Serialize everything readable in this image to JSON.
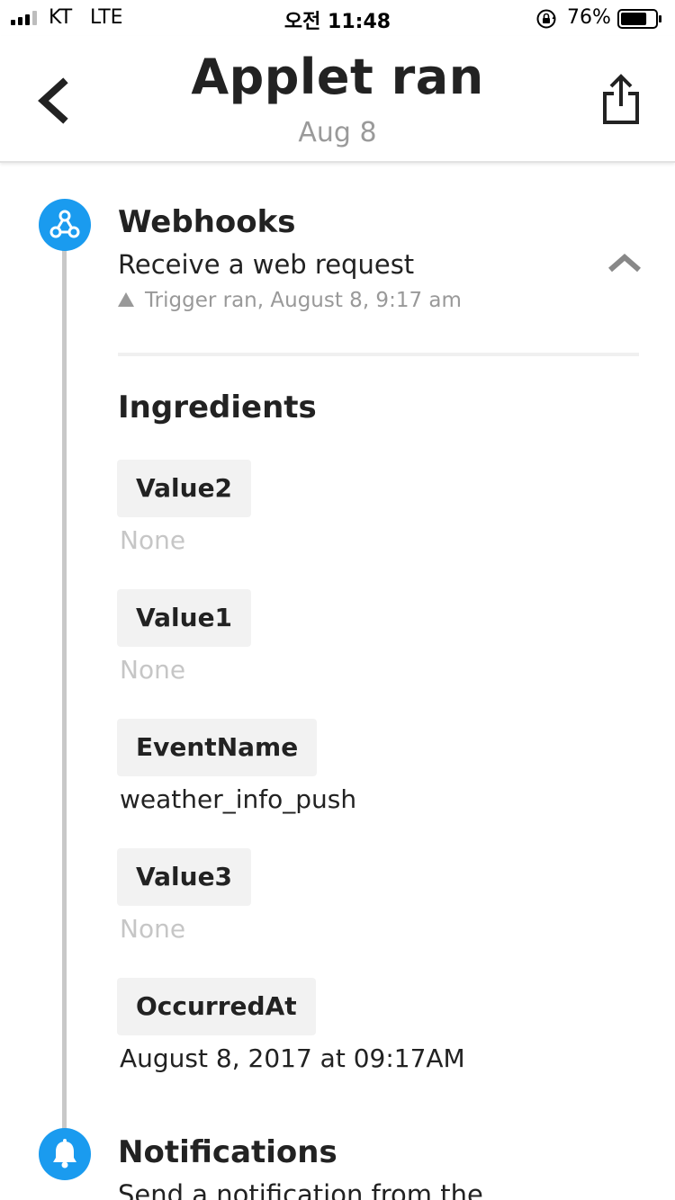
{
  "status_bar": {
    "carrier": "KT",
    "network": "LTE",
    "time": "오전 11:48",
    "battery_percent": "76%",
    "battery_level": 0.76
  },
  "header": {
    "title": "Applet ran",
    "subtitle": "Aug 8"
  },
  "trigger": {
    "service": "Webhooks",
    "action": "Receive a web request",
    "status": "Trigger ran, August 8, 9:17 am",
    "accent_color": "#1a9bef"
  },
  "ingredients": {
    "heading": "Ingredients",
    "items": [
      {
        "label": "Value2",
        "value": "None"
      },
      {
        "label": "Value1",
        "value": "None"
      },
      {
        "label": "EventName",
        "value": "weather_info_push"
      },
      {
        "label": "Value3",
        "value": "None"
      },
      {
        "label": "OccurredAt",
        "value": "August 8, 2017 at 09:17AM"
      }
    ]
  },
  "action": {
    "service": "Notifications",
    "action": "Send a notification from the"
  }
}
